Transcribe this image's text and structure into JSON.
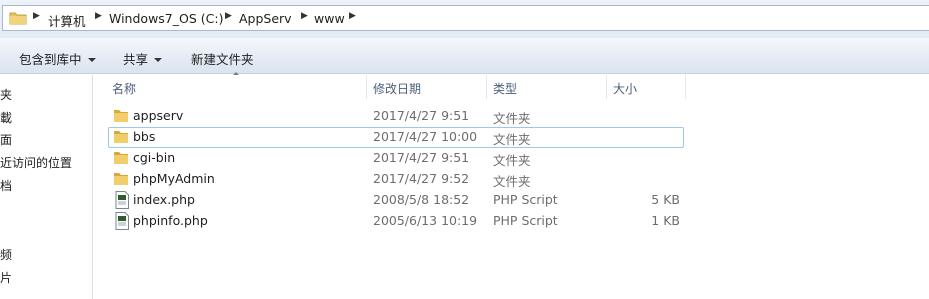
{
  "address": {
    "crumbs": [
      "计算机",
      "Windows7_OS (C:)",
      "AppServ",
      "www"
    ]
  },
  "toolbar": {
    "include_label": "包含到库中",
    "share_label": "共享",
    "new_folder_label": "新建文件夹"
  },
  "nav": {
    "items": [
      "夹",
      "載",
      "面",
      "近访问的位置",
      "档",
      "频",
      "片"
    ]
  },
  "columns": {
    "name": "名称",
    "modified": "修改日期",
    "type": "类型",
    "size": "大小"
  },
  "files": [
    {
      "name": "appserv",
      "modified": "2017/4/27 9:51",
      "type": "文件夹",
      "size": "",
      "icon": "folder-icon"
    },
    {
      "name": "bbs",
      "modified": "2017/4/27 10:00",
      "type": "文件夹",
      "size": "",
      "icon": "folder-icon"
    },
    {
      "name": "cgi-bin",
      "modified": "2017/4/27 9:51",
      "type": "文件夹",
      "size": "",
      "icon": "folder-icon"
    },
    {
      "name": "phpMyAdmin",
      "modified": "2017/4/27 9:52",
      "type": "文件夹",
      "size": "",
      "icon": "folder-icon"
    },
    {
      "name": "index.php",
      "modified": "2008/5/8 18:52",
      "type": "PHP Script",
      "size": "5 KB",
      "icon": "php-file-icon"
    },
    {
      "name": "phpinfo.php",
      "modified": "2005/6/13 10:19",
      "type": "PHP Script",
      "size": "1 KB",
      "icon": "php-file-icon"
    }
  ],
  "colors": {
    "folder": "#e8c25a",
    "selection_border": "#99c7f0",
    "header_text": "#4c607a"
  }
}
